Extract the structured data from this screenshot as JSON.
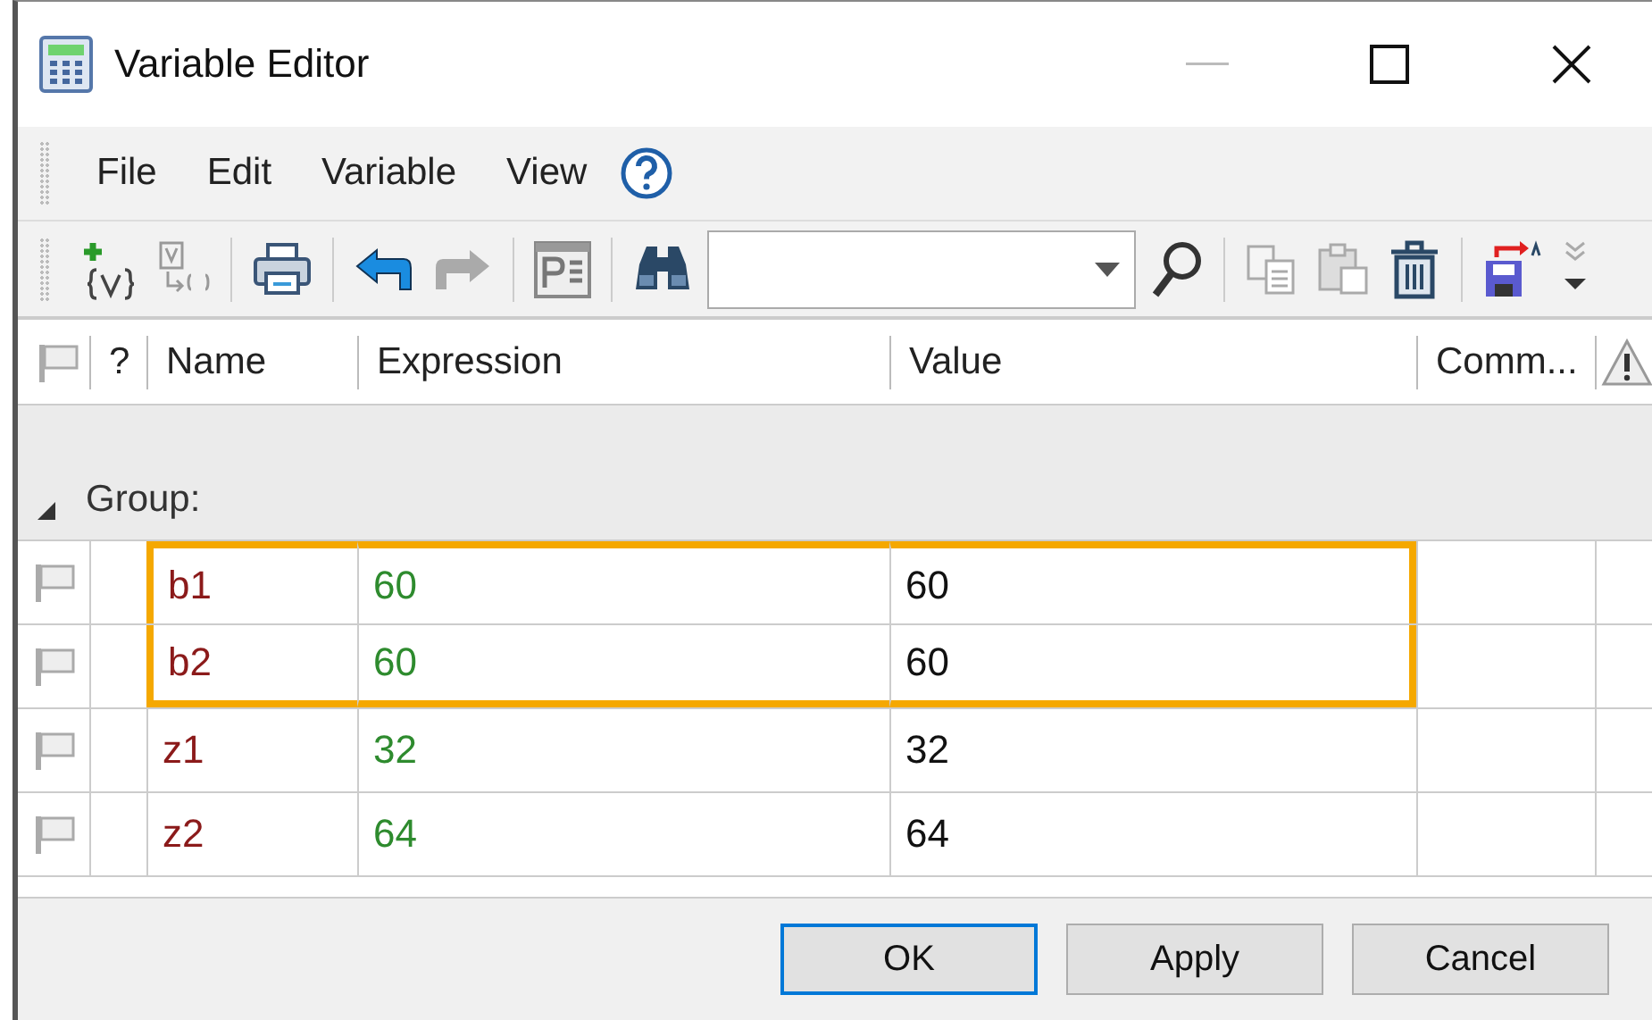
{
  "window": {
    "title": "Variable Editor"
  },
  "menu": [
    "File",
    "Edit",
    "Variable",
    "View"
  ],
  "table": {
    "columns": [
      "?",
      "Name",
      "Expression",
      "Value",
      "Comm..."
    ],
    "group": {
      "label": "Group:",
      "expanded": true
    },
    "rows": [
      {
        "name": "b1",
        "expression": "60",
        "value": "60",
        "highlighted": true
      },
      {
        "name": "b2",
        "expression": "60",
        "value": "60",
        "highlighted": true
      },
      {
        "name": "z1",
        "expression": "32",
        "value": "32",
        "highlighted": false
      },
      {
        "name": "z2",
        "expression": "64",
        "value": "64",
        "highlighted": false
      }
    ]
  },
  "buttons": [
    {
      "label": "OK",
      "default": true
    },
    {
      "label": "Apply",
      "default": false
    },
    {
      "label": "Cancel",
      "default": false
    }
  ]
}
